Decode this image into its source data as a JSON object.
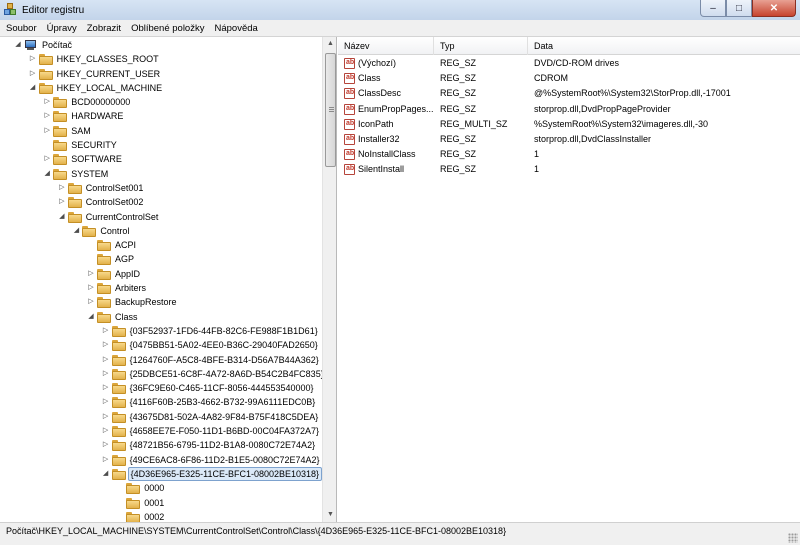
{
  "window": {
    "title": "Editor registru",
    "controls": {
      "minimize": "–",
      "maximize": "□",
      "close": "✕"
    }
  },
  "menu": [
    "Soubor",
    "Úpravy",
    "Zobrazit",
    "Oblíbené položky",
    "Nápověda"
  ],
  "tree": [
    {
      "label": "Počítač",
      "level": 0,
      "expanded": true,
      "icon": "computer-icon"
    },
    {
      "label": "HKEY_CLASSES_ROOT",
      "level": 1,
      "expanded": false
    },
    {
      "label": "HKEY_CURRENT_USER",
      "level": 1,
      "expanded": false
    },
    {
      "label": "HKEY_LOCAL_MACHINE",
      "level": 1,
      "expanded": true
    },
    {
      "label": "BCD00000000",
      "level": 2,
      "expanded": false
    },
    {
      "label": "HARDWARE",
      "level": 2,
      "expanded": false
    },
    {
      "label": "SAM",
      "level": 2,
      "expanded": false
    },
    {
      "label": "SECURITY",
      "level": 2,
      "expanded": null
    },
    {
      "label": "SOFTWARE",
      "level": 2,
      "expanded": false
    },
    {
      "label": "SYSTEM",
      "level": 2,
      "expanded": true
    },
    {
      "label": "ControlSet001",
      "level": 3,
      "expanded": false
    },
    {
      "label": "ControlSet002",
      "level": 3,
      "expanded": false
    },
    {
      "label": "CurrentControlSet",
      "level": 3,
      "expanded": true
    },
    {
      "label": "Control",
      "level": 4,
      "expanded": true
    },
    {
      "label": "ACPI",
      "level": 5,
      "expanded": null
    },
    {
      "label": "AGP",
      "level": 5,
      "expanded": null
    },
    {
      "label": "AppID",
      "level": 5,
      "expanded": false
    },
    {
      "label": "Arbiters",
      "level": 5,
      "expanded": false
    },
    {
      "label": "BackupRestore",
      "level": 5,
      "expanded": false
    },
    {
      "label": "Class",
      "level": 5,
      "expanded": true
    },
    {
      "label": "{03F52937-1FD6-44FB-82C6-FE988F1B1D61}",
      "level": 6,
      "expanded": false
    },
    {
      "label": "{0475BB51-5A02-4EE0-B36C-29040FAD2650}",
      "level": 6,
      "expanded": false
    },
    {
      "label": "{1264760F-A5C8-4BFE-B314-D56A7B44A362}",
      "level": 6,
      "expanded": false
    },
    {
      "label": "{25DBCE51-6C8F-4A72-8A6D-B54C2B4FC835}",
      "level": 6,
      "expanded": false
    },
    {
      "label": "{36FC9E60-C465-11CF-8056-444553540000}",
      "level": 6,
      "expanded": false
    },
    {
      "label": "{4116F60B-25B3-4662-B732-99A6111EDC0B}",
      "level": 6,
      "expanded": false
    },
    {
      "label": "{43675D81-502A-4A82-9F84-B75F418C5DEA}",
      "level": 6,
      "expanded": false
    },
    {
      "label": "{4658EE7E-F050-11D1-B6BD-00C04FA372A7}",
      "level": 6,
      "expanded": false
    },
    {
      "label": "{48721B56-6795-11D2-B1A8-0080C72E74A2}",
      "level": 6,
      "expanded": false
    },
    {
      "label": "{49CE6AC8-6F86-11D2-B1E5-0080C72E74A2}",
      "level": 6,
      "expanded": false
    },
    {
      "label": "{4D36E965-E325-11CE-BFC1-08002BE10318}",
      "level": 6,
      "expanded": true,
      "selected": true
    },
    {
      "label": "0000",
      "level": 7,
      "expanded": null
    },
    {
      "label": "0001",
      "level": 7,
      "expanded": null
    },
    {
      "label": "0002",
      "level": 7,
      "expanded": null
    }
  ],
  "list": {
    "columns": [
      "Název",
      "Typ",
      "Data"
    ],
    "rows": [
      {
        "name": "(Výchozí)",
        "type": "REG_SZ",
        "data": "DVD/CD-ROM drives"
      },
      {
        "name": "Class",
        "type": "REG_SZ",
        "data": "CDROM"
      },
      {
        "name": "ClassDesc",
        "type": "REG_SZ",
        "data": "@%SystemRoot%\\System32\\StorProp.dll,-17001"
      },
      {
        "name": "EnumPropPages...",
        "type": "REG_SZ",
        "data": "storprop.dll,DvdPropPageProvider"
      },
      {
        "name": "IconPath",
        "type": "REG_MULTI_SZ",
        "data": "%SystemRoot%\\System32\\imageres.dll,-30"
      },
      {
        "name": "Installer32",
        "type": "REG_SZ",
        "data": "storprop.dll,DvdClassInstaller"
      },
      {
        "name": "NoInstallClass",
        "type": "REG_SZ",
        "data": "1"
      },
      {
        "name": "SilentInstall",
        "type": "REG_SZ",
        "data": "1"
      }
    ]
  },
  "status": "Počítač\\HKEY_LOCAL_MACHINE\\SYSTEM\\CurrentControlSet\\Control\\Class\\{4D36E965-E325-11CE-BFC1-08002BE10318}"
}
